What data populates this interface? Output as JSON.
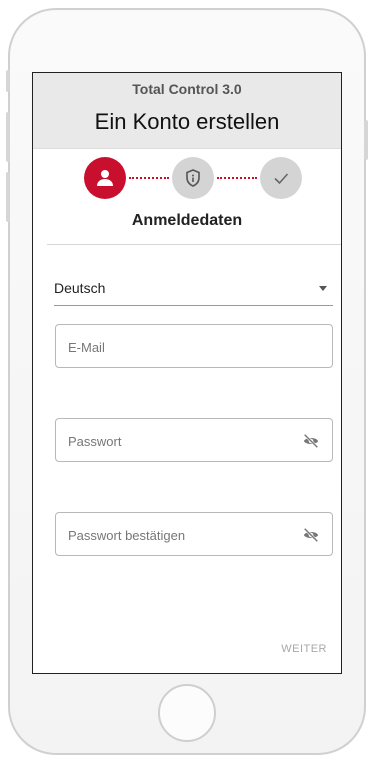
{
  "header": {
    "app_title": "Total Control 3.0",
    "page_title": "Ein Konto erstellen"
  },
  "stepper": {
    "steps": [
      {
        "icon": "person-icon",
        "state": "active"
      },
      {
        "icon": "shield-icon",
        "state": "pending"
      },
      {
        "icon": "check-icon",
        "state": "pending"
      }
    ],
    "current_label": "Anmeldedaten"
  },
  "form": {
    "language": {
      "value": "Deutsch"
    },
    "email": {
      "placeholder": "E-Mail",
      "value": ""
    },
    "password": {
      "placeholder": "Passwort",
      "value": ""
    },
    "password_confirm": {
      "placeholder": "Passwort bestätigen",
      "value": ""
    }
  },
  "footer": {
    "next_label": "WEITER"
  },
  "colors": {
    "accent": "#c8102e",
    "inactive_step": "#d4d4d4",
    "header_bg": "#e9e9e9"
  }
}
